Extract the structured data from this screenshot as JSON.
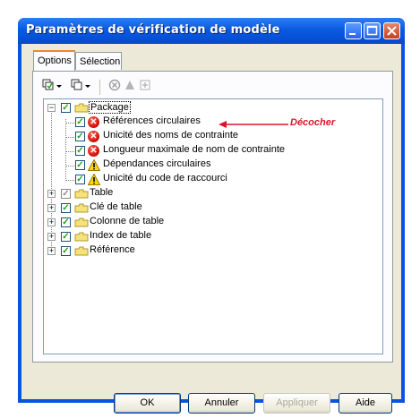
{
  "window": {
    "title": "Paramètres de vérification de modèle"
  },
  "tabs": [
    {
      "label": "Options",
      "active": true
    },
    {
      "label": "Sélection",
      "active": false
    }
  ],
  "toolbar": {
    "icons": [
      "select-all-icon",
      "dropdown-arrow-icon",
      "deselect-icon",
      "dropdown-arrow-icon",
      "error-icon",
      "warning-icon",
      "add-icon"
    ]
  },
  "tree": {
    "package": {
      "label": "Package",
      "expander": "−"
    },
    "package_children": [
      {
        "label": "Références circulaires",
        "status": "error"
      },
      {
        "label": "Unicité des noms de contrainte",
        "status": "error"
      },
      {
        "label": "Longueur maximale de nom de contrainte",
        "status": "error"
      },
      {
        "label": "Dépendances circulaires",
        "status": "warning"
      },
      {
        "label": "Unicité du code de raccourci",
        "status": "warning"
      }
    ],
    "top_items": [
      {
        "label": "Table",
        "expander": "+",
        "checkbox": "partial"
      },
      {
        "label": "Clé de table",
        "expander": "+",
        "checkbox": "checked"
      },
      {
        "label": "Colonne de table",
        "expander": "+",
        "checkbox": "checked"
      },
      {
        "label": "Index de table",
        "expander": "+",
        "checkbox": "checked"
      },
      {
        "label": "Référence",
        "expander": "+",
        "checkbox": "checked"
      }
    ]
  },
  "annotation": {
    "text": "Décocher",
    "color": "#d8152b"
  },
  "buttons": {
    "ok": "OK",
    "cancel": "Annuler",
    "apply": "Appliquer",
    "help": "Aide"
  },
  "colors": {
    "titlebar": "#0a5ae0",
    "client": "#ece9d8",
    "accent_tab": "#e68b2c",
    "check": "#21a121",
    "error": "#d4140b"
  }
}
